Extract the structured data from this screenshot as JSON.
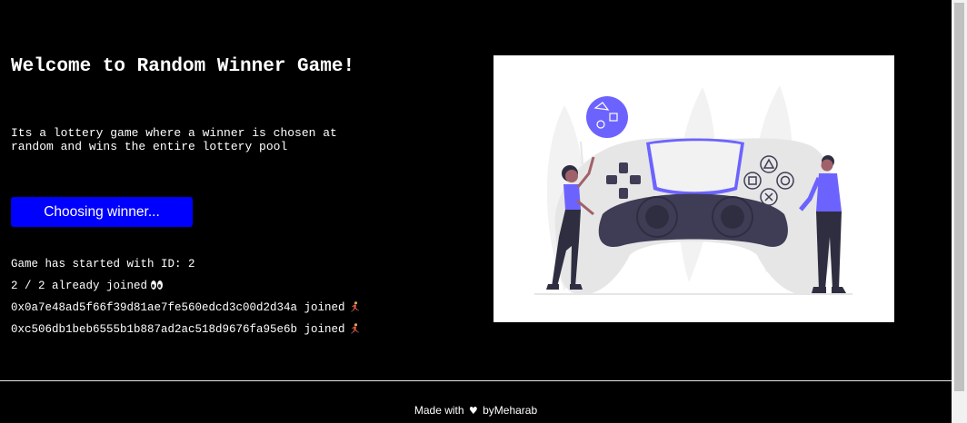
{
  "header": {
    "title": "Welcome to Random Winner Game!",
    "description": "Its a lottery game where a winner is chosen at random and wins the entire lottery pool"
  },
  "action": {
    "button_label": "Choosing winner..."
  },
  "status": {
    "game_started": "Game has started with ID: 2",
    "players_joined": "2 / 2 already joined",
    "players": [
      "0x0a7e48ad5f66f39d81ae7fe560edcd3c00d2d34a joined",
      "0xc506db1beb6555b1b887ad2ac518d9676fa95e6b joined"
    ]
  },
  "icons": {
    "eyes": "eyes-icon",
    "runner": "running-person-icon",
    "heart": "heart-icon"
  },
  "footer": {
    "made_with": "Made with",
    "by": "byMeharab"
  },
  "colors": {
    "background": "#000000",
    "button": "#0000ff",
    "accent": "#6c63ff",
    "controller": "#e6e6e6",
    "dark": "#3f3d56"
  }
}
